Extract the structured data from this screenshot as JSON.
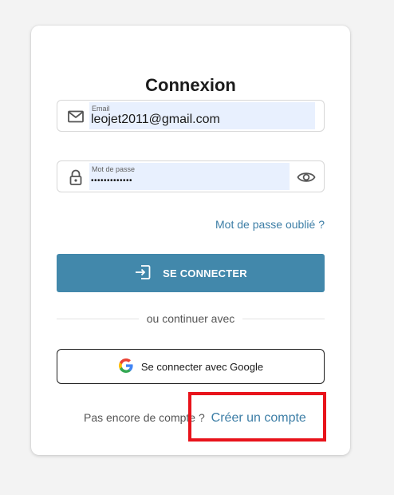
{
  "login": {
    "title": "Connexion",
    "email": {
      "label": "Email",
      "value": "leojet2011@gmail.com"
    },
    "password": {
      "label": "Mot de passe",
      "masked_value": "•••••••••••••"
    },
    "forgot_password": "Mot de passe oublié ?",
    "submit_label": "SE CONNECTER",
    "divider_text": "ou continuer avec",
    "google_label": "Se connecter avec Google",
    "signup_prompt": "Pas encore de compte ?",
    "signup_link": "Créer un compte"
  },
  "colors": {
    "primary": "#4288ab",
    "link": "#3d7ea6",
    "autofill": "#e8f0fe",
    "highlight": "#e8131b"
  },
  "icons": {
    "email": "mail-icon",
    "password": "lock-icon",
    "toggle_visibility": "eye-icon",
    "submit": "login-icon",
    "google": "google-logo-icon"
  }
}
